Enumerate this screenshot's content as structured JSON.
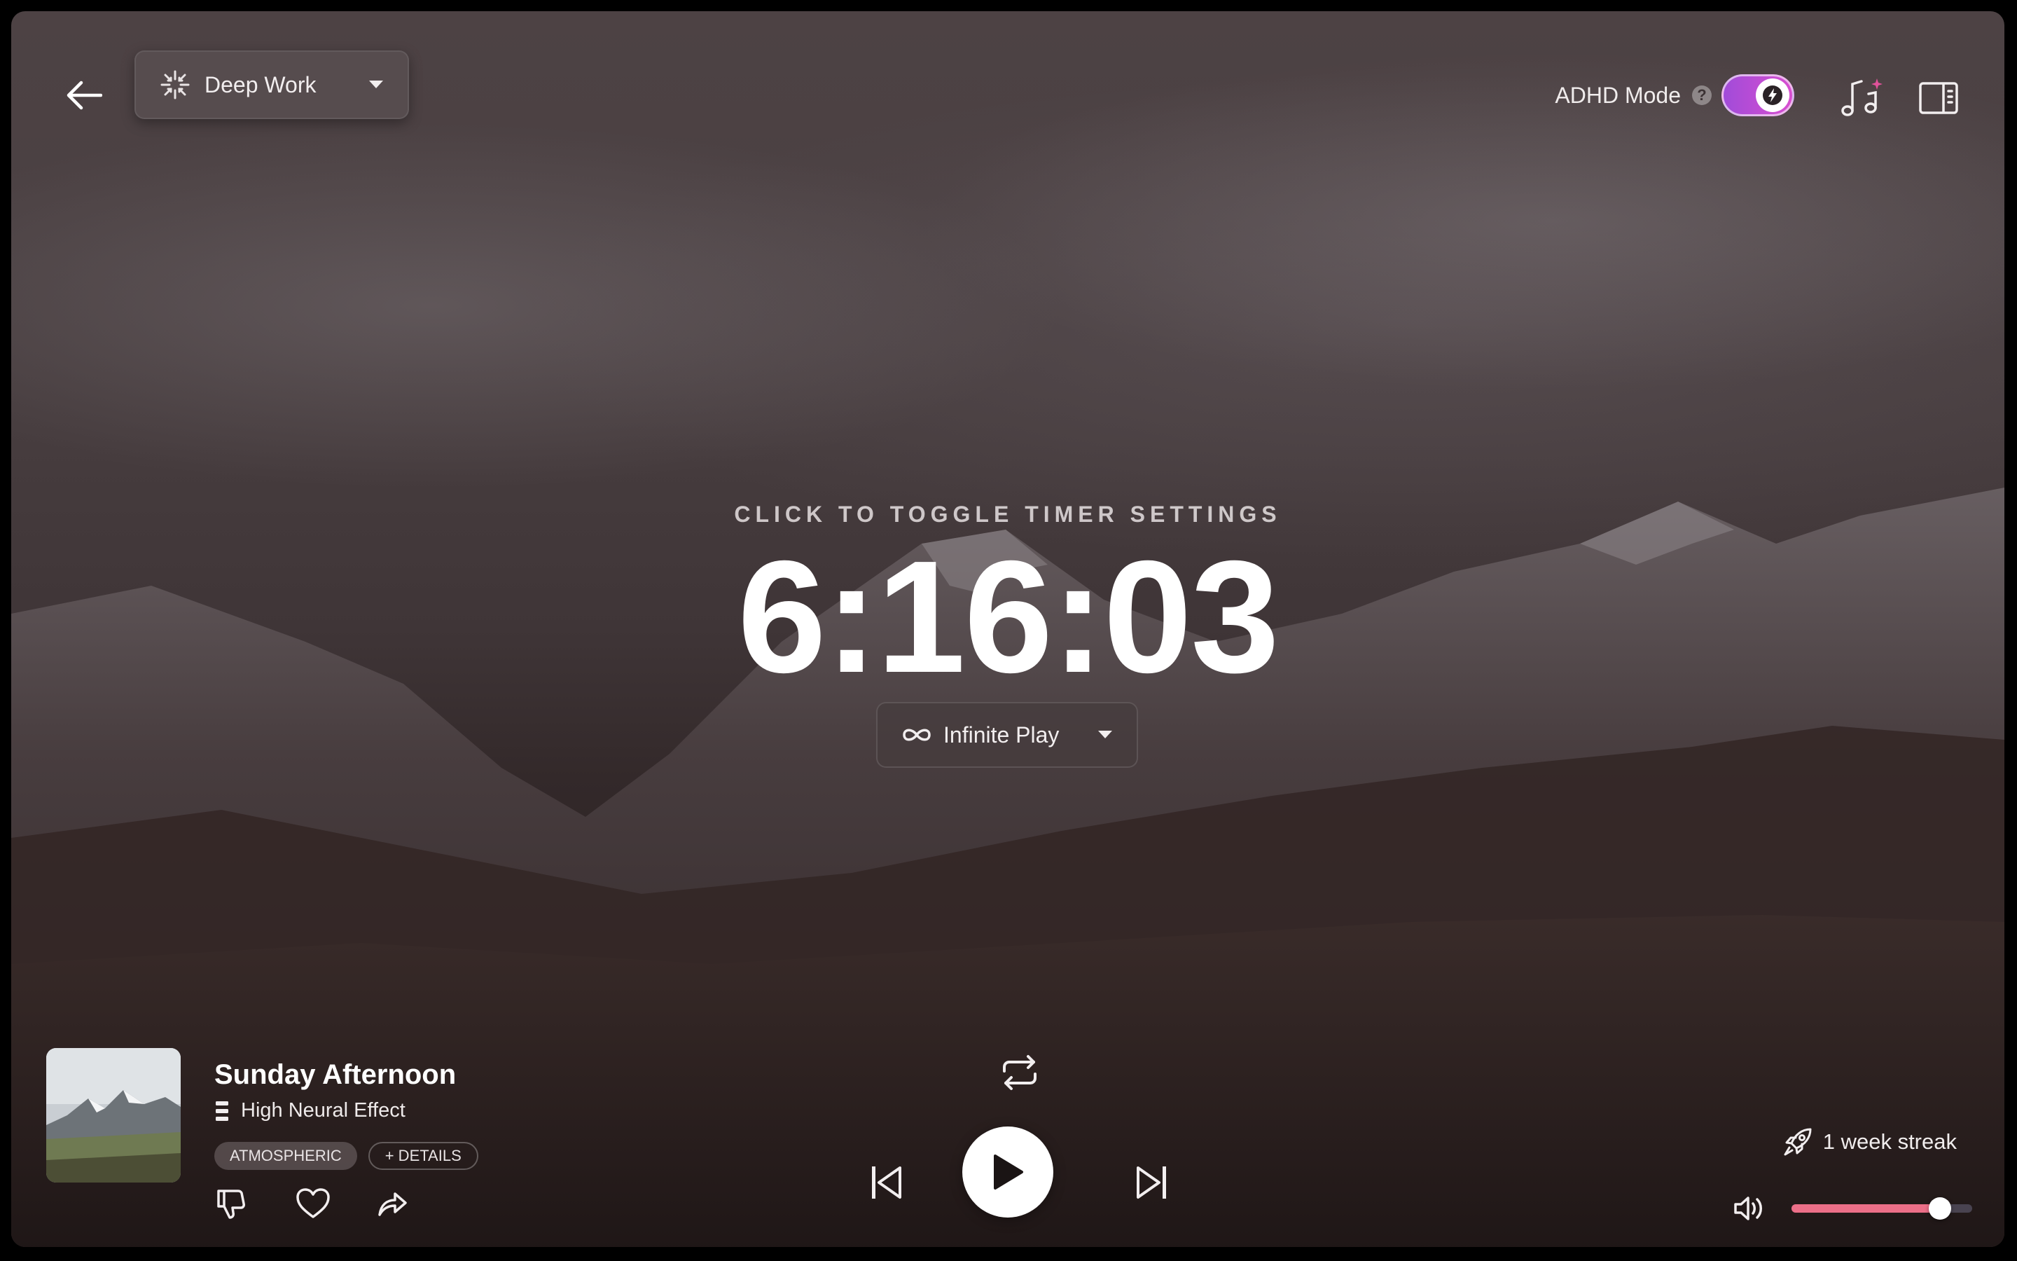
{
  "header": {
    "back_icon": "arrow-left-icon",
    "mode_select": {
      "value": "Deep Work",
      "icon": "deep-work-icon"
    },
    "adhd_mode": {
      "label": "ADHD Mode",
      "help_icon_text": "?",
      "enabled": true
    },
    "music_icon": "music-notes-sparkle-icon",
    "panel_icon": "side-panel-icon"
  },
  "timer": {
    "hint": "CLICK TO TOGGLE TIMER SETTINGS",
    "time": "6:16:03",
    "play_mode": {
      "value": "Infinite Play",
      "icon": "infinity-icon"
    }
  },
  "track": {
    "title": "Sunday Afternoon",
    "effect": "High Neural Effect",
    "tags": [
      "ATMOSPHERIC",
      "+ DETAILS"
    ],
    "actions": [
      "thumbs-down-icon",
      "heart-icon",
      "share-icon"
    ]
  },
  "player": {
    "controls": [
      "repeat-icon",
      "skip-previous-icon",
      "play-icon",
      "skip-next-icon"
    ]
  },
  "streak": {
    "text": "1 week streak",
    "icon": "rocket-icon"
  },
  "volume": {
    "level": 0.82
  },
  "colors": {
    "toggle_start": "#a14bd9",
    "toggle_end": "#d84fd0",
    "volume_fill": "#ec6f88",
    "background_top": "#4d4244",
    "background_bottom": "#1c1515"
  }
}
